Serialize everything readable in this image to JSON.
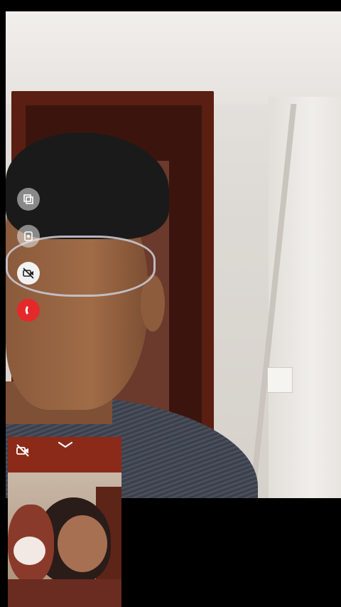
{
  "call": {
    "controls": [
      {
        "name": "flip-camera-icon"
      },
      {
        "name": "effects-icon"
      },
      {
        "name": "video-off-icon"
      },
      {
        "name": "end-call-icon"
      }
    ],
    "self_view": {
      "status_icon": "video-off-icon",
      "collapse_icon": "chevron-down-icon"
    },
    "colors": {
      "end_call": "#e5292b",
      "background": "#000000"
    }
  }
}
